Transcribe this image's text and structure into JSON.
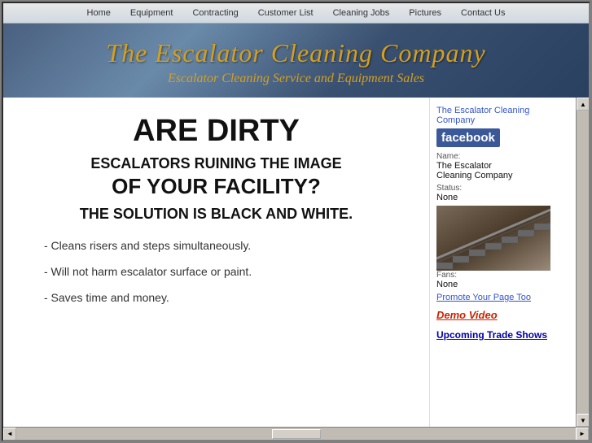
{
  "nav": {
    "items": [
      "Home",
      "Equipment",
      "Contracting",
      "Customer List",
      "Cleaning Jobs",
      "Pictures",
      "Contact Us"
    ]
  },
  "header": {
    "title": "The Escalator Cleaning Company",
    "subtitle": "Escalator Cleaning Service and Equipment Sales"
  },
  "main": {
    "headline1": "ARE DIRTY",
    "headline2": "ESCALATORS RUINING THE IMAGE",
    "headline3": "OF YOUR FACILITY?",
    "headline4": "THE SOLUTION IS BLACK AND WHITE.",
    "bullets": [
      "- Cleans risers and steps simultaneously.",
      "- Will not harm escalator surface or paint.",
      "- Saves time and money."
    ]
  },
  "sidebar": {
    "company_name": "The Escalator Cleaning Company",
    "facebook_label": "facebook",
    "name_label": "Name:",
    "name_value": "The Escalator\nCleaning Company",
    "status_label": "Status:",
    "status_value": "None",
    "fans_label": "Fans:",
    "fans_value": "None",
    "promote_link": "Promote Your Page Too",
    "demo_video_link": "Demo Video",
    "trade_shows_link": "Upcoming Trade Shows"
  },
  "scrollbar": {
    "up_arrow": "▲",
    "down_arrow": "▼",
    "left_arrow": "◄",
    "right_arrow": "►"
  }
}
